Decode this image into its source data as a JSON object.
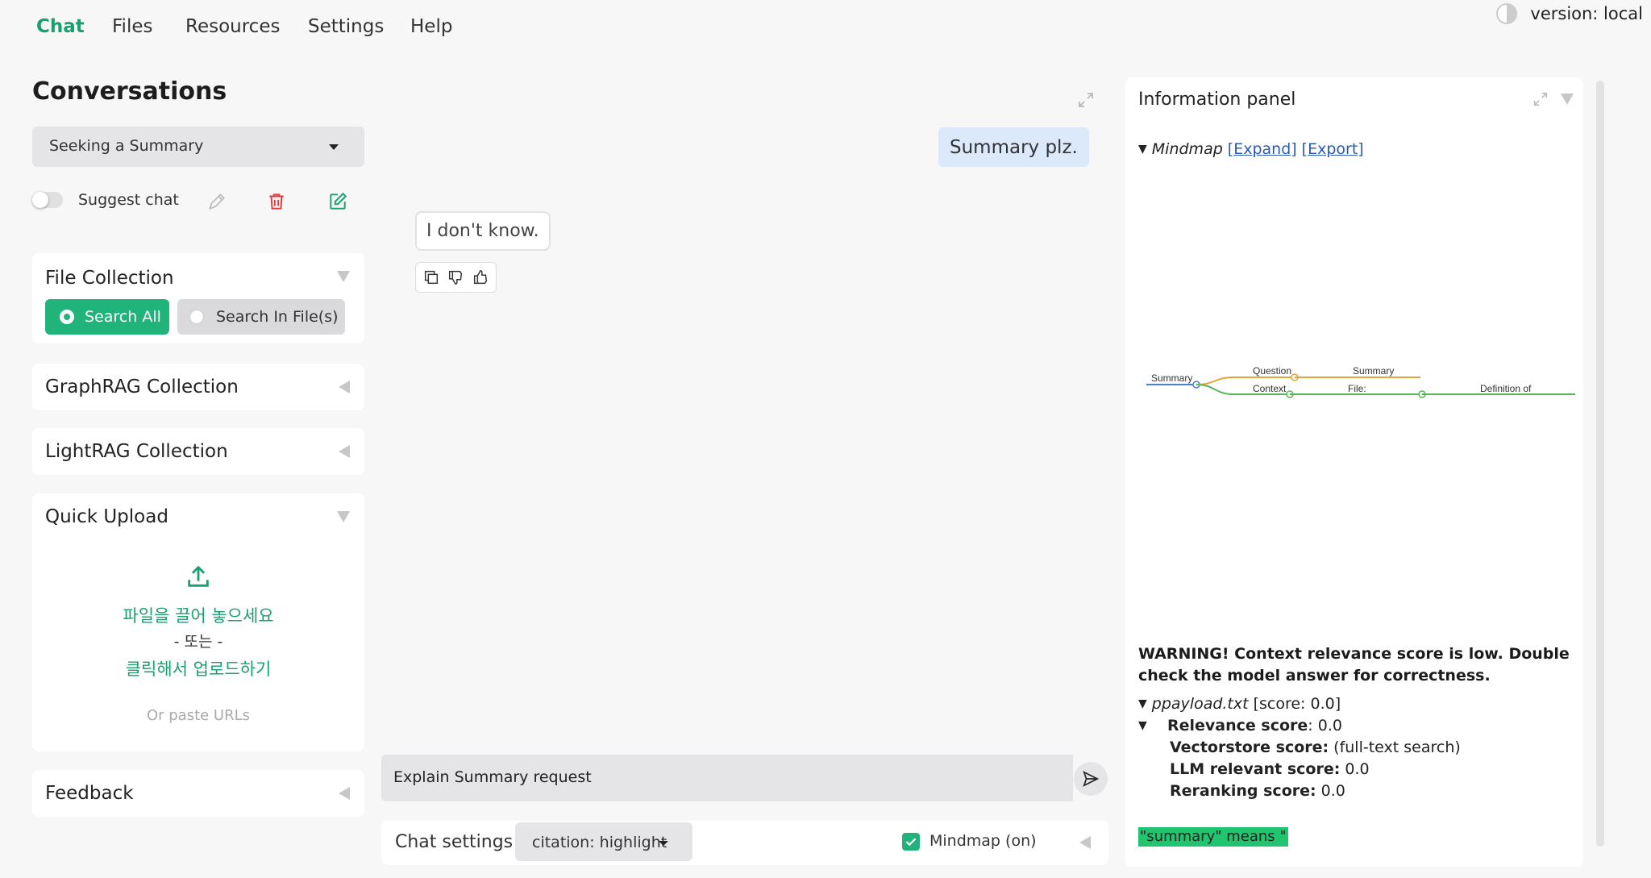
{
  "nav": {
    "tabs": [
      {
        "label": "Chat"
      },
      {
        "label": "Files"
      },
      {
        "label": "Resources"
      },
      {
        "label": "Settings"
      },
      {
        "label": "Help"
      }
    ]
  },
  "version": "version: local",
  "sidebar": {
    "title": "Conversations",
    "conversation_selected": "Seeking a Summary",
    "suggest_chat_label": "Suggest chat",
    "file_collection": {
      "title": "File Collection",
      "options": [
        "Search All",
        "Search In File(s)"
      ]
    },
    "graphrag_title": "GraphRAG Collection",
    "lightrag_title": "LightRAG Collection",
    "quick_upload": {
      "title": "Quick Upload",
      "drop_text": "파일을 끌어 놓으세요",
      "or_text": "- 또는 -",
      "click_text": "클릭해서 업로드하기",
      "paste_urls": "Or paste URLs"
    },
    "feedback_title": "Feedback"
  },
  "chat": {
    "user_message": "Summary plz.",
    "bot_message": "I don't know.",
    "input_value": "Explain Summary request",
    "settings_label": "Chat settings",
    "citation_value": "citation: highlight",
    "mindmap_label": "Mindmap (on)"
  },
  "info_panel": {
    "title": "Information panel",
    "mindmap_label": "Mindmap",
    "expand_link": "[Expand]",
    "export_link": "[Export]",
    "mindmap_nodes": [
      "Summary",
      "Question",
      "Summary",
      "Context",
      "File:",
      "Definition of"
    ],
    "warning": "WARNING! Context relevance score is low. Double check the model answer for correctness.",
    "source_file": "ppayload.txt",
    "source_score": "[score: 0.0]",
    "relevance_label": "Relevance score",
    "relevance_value": ": 0.0",
    "vectorstore_label": "Vectorstore score:",
    "vectorstore_value": " (full-text search)",
    "llm_label": "LLM relevant score:",
    "llm_value": " 0.0",
    "rerank_label": "Reranking score:",
    "rerank_value": " 0.0",
    "highlight": "\"summary\" means \""
  },
  "colors": {
    "accent": "#18a06e",
    "delete": "#e03b3b",
    "highlight_bg": "#21c56f",
    "user_bubble": "#dbe9fb"
  }
}
